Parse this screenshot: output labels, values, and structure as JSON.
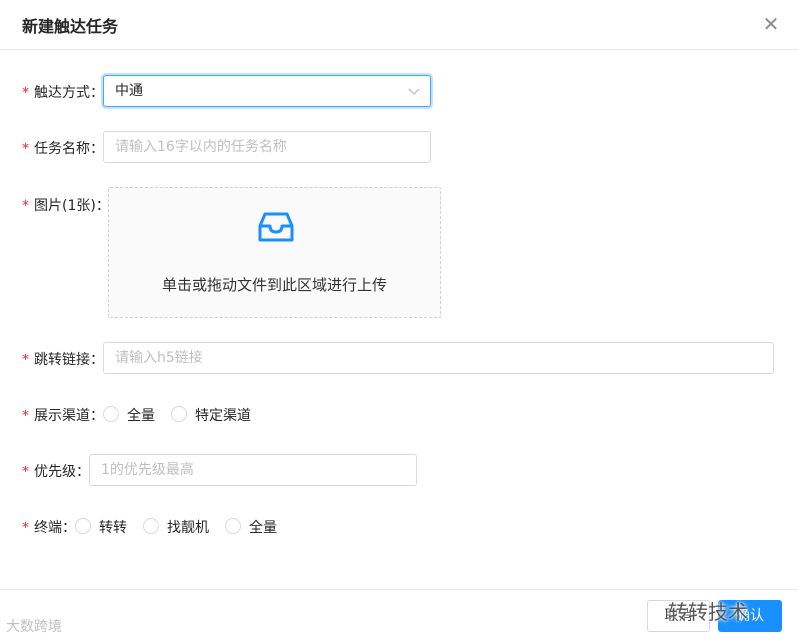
{
  "dialog": {
    "title": "新建触达任务",
    "close_icon": "close-icon"
  },
  "form": {
    "method": {
      "label": "触达方式",
      "value": "中通"
    },
    "task_name": {
      "label": "任务名称",
      "placeholder": "请输入16字以内的任务名称"
    },
    "image": {
      "label": "图片(1张)",
      "upload_text": "单击或拖动文件到此区域进行上传",
      "icon": "inbox-icon"
    },
    "jump_link": {
      "label": "跳转链接",
      "placeholder": "请输入h5链接"
    },
    "channel": {
      "label": "展示渠道",
      "options": [
        "全量",
        "特定渠道"
      ]
    },
    "priority": {
      "label": "优先级",
      "placeholder": "1的优先级最高"
    },
    "terminal": {
      "label": "终端",
      "options": [
        "转转",
        "找靓机",
        "全量"
      ]
    }
  },
  "footer": {
    "cancel_label": "取消",
    "ok_label": "确认"
  },
  "watermarks": {
    "left": "大数跨境",
    "right": "转转技术"
  },
  "colors": {
    "required": "#f5222d",
    "primary": "#1890ff",
    "focus_border": "#40a9ff"
  }
}
